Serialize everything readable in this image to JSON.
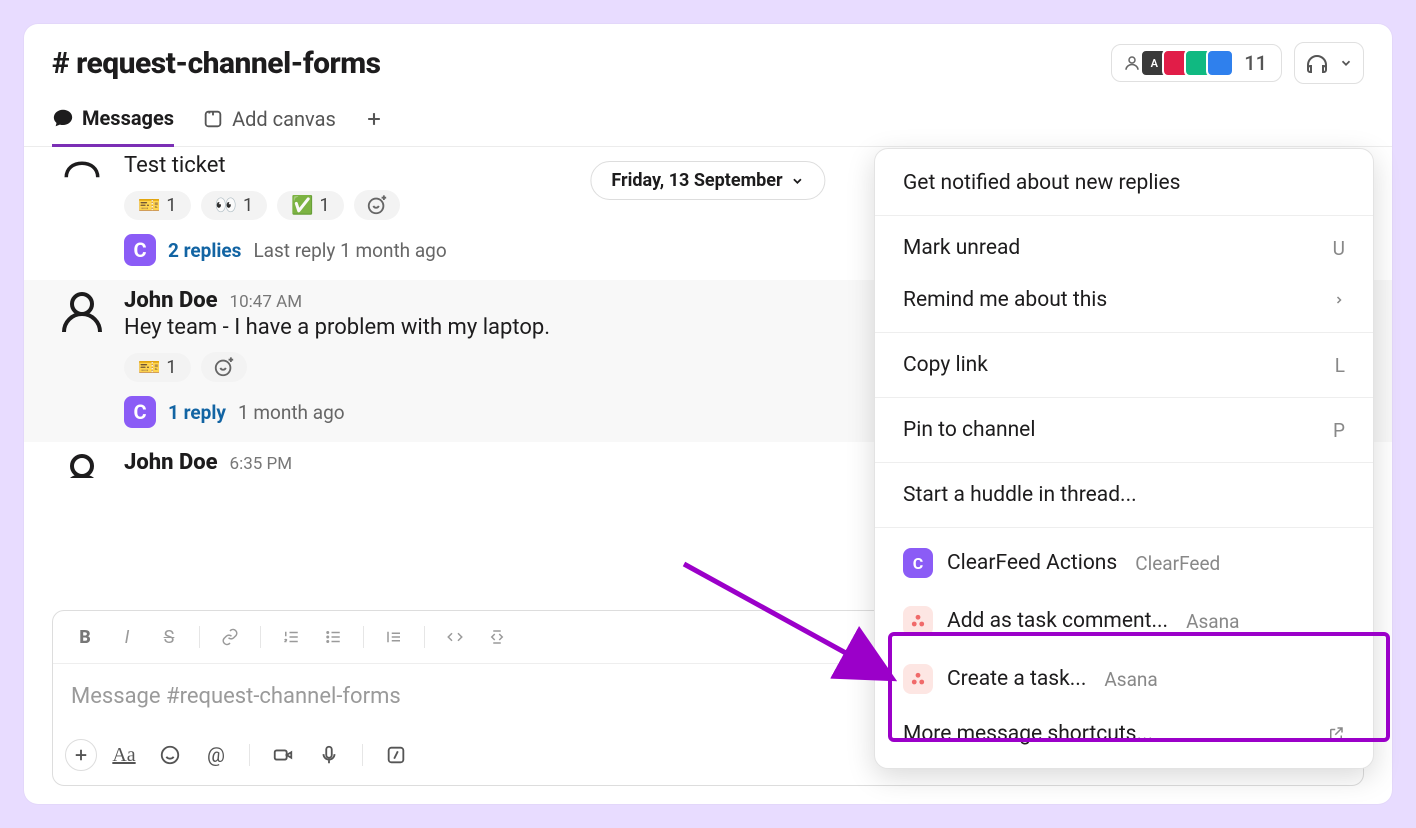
{
  "channel": {
    "title": "# request-channel-forms"
  },
  "header": {
    "member_count": "11",
    "avatars": [
      {
        "bg": "#ffffff",
        "label": ""
      },
      {
        "bg": "#3a3a3a",
        "label": "A"
      },
      {
        "bg": "#e11d48",
        "label": ""
      },
      {
        "bg": "#10b981",
        "label": ""
      },
      {
        "bg": "#2f80ed",
        "label": ""
      }
    ]
  },
  "tabs": {
    "messages": "Messages",
    "add_canvas": "Add canvas"
  },
  "date_divider": "Friday, 13 September",
  "messages": [
    {
      "name": "",
      "time": "",
      "text": "Test ticket",
      "reactions": [
        {
          "emoji": "🎫",
          "count": "1"
        },
        {
          "emoji": "👀",
          "count": "1"
        },
        {
          "emoji": "✅",
          "count": "1"
        }
      ],
      "thread": {
        "replies": "2 replies",
        "meta": "Last reply 1 month ago"
      }
    },
    {
      "name": "John Doe",
      "time": "10:47 AM",
      "text": "Hey team - I have a problem with my laptop.",
      "reactions": [
        {
          "emoji": "🎫",
          "count": "1"
        }
      ],
      "thread": {
        "replies": "1 reply",
        "meta": "1 month ago"
      }
    },
    {
      "name": "John Doe",
      "time": "6:35 PM",
      "text": ""
    }
  ],
  "composer": {
    "placeholder": "Message #request-channel-forms"
  },
  "context_menu": {
    "notify": "Get notified about new replies",
    "mark_unread": {
      "label": "Mark unread",
      "key": "U"
    },
    "remind": "Remind me about this",
    "copy_link": {
      "label": "Copy link",
      "key": "L"
    },
    "pin": {
      "label": "Pin to channel",
      "key": "P"
    },
    "huddle": "Start a huddle in thread...",
    "clearfeed": {
      "label": "ClearFeed Actions",
      "sub": "ClearFeed"
    },
    "asana_comment": {
      "label": "Add as task comment...",
      "sub": "Asana"
    },
    "asana_create": {
      "label": "Create a task...",
      "sub": "Asana"
    },
    "more_shortcuts": "More message shortcuts..."
  }
}
